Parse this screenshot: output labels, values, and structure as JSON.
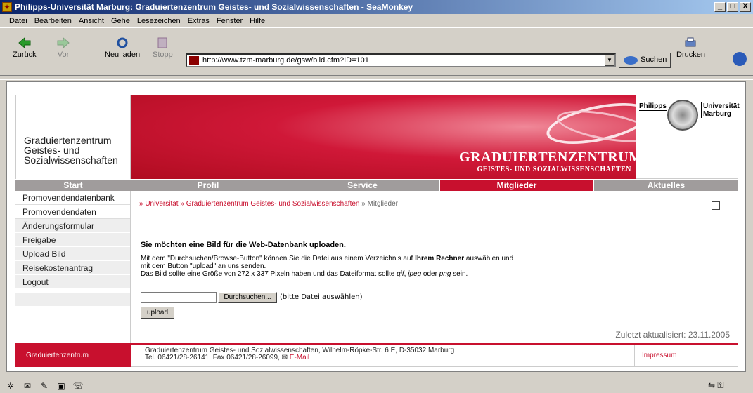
{
  "window": {
    "title": "Philipps-Universität Marburg: Graduiertenzentrum Geistes- und Sozialwissenschaften - SeaMonkey",
    "min": "_",
    "max": "□",
    "close": "X"
  },
  "menu": [
    "Datei",
    "Bearbeiten",
    "Ansicht",
    "Gehe",
    "Lesezeichen",
    "Extras",
    "Fenster",
    "Hilfe"
  ],
  "toolbar": {
    "back": "Zurück",
    "forward": "Vor",
    "reload": "Neu laden",
    "stop": "Stopp",
    "url": "http://www.tzm-marburg.de/gsw/bild.cfm?ID=101",
    "search": "Suchen",
    "print": "Drucken"
  },
  "header": {
    "left_title_line1": "Graduiertenzentrum",
    "left_title_line2": "Geistes- und",
    "left_title_line3": "Sozialwissenschaften",
    "banner_title": "GRADUIERTENZENTRUM",
    "banner_subtitle": "GEISTES- UND SOZIALWISSENSCHAFTEN",
    "uni_left": "Philipps",
    "uni_right_line1": "Universität",
    "uni_right_line2": "Marburg"
  },
  "nav": [
    "Start",
    "Profil",
    "Service",
    "Mitglieder",
    "Aktuelles"
  ],
  "sidebar": [
    "Promovendendatenbank",
    "Promovendendaten",
    "Änderungsformular",
    "Freigabe",
    "Upload Bild",
    "Reisekostenantrag",
    "Logout"
  ],
  "breadcrumb": {
    "part1": "» Universität",
    "part2": "» Graduiertenzentrum Geistes- und Sozialwissenschaften",
    "part3": "» Mitglieder"
  },
  "main": {
    "heading": "Sie möchten eine Bild für die Web-Datenbank uploaden.",
    "p1a": "Mit dem \"Durchsuchen/Browse-Button\" können Sie die Datei aus einem Verzeichnis auf ",
    "p1b": "Ihrem Rechner",
    "p1c": " auswählen und",
    "p2": "mit dem Button \"upload\" an uns senden.",
    "p3a": "Das Bild sollte eine Größe von 272 x 337 Pixeln haben und das Dateiformat sollte ",
    "p3b": "gif",
    "p3c": ", ",
    "p3d": "jpeg",
    "p3e": " oder ",
    "p3f": "png",
    "p3g": " sein.",
    "browse": "Durchsuchen...",
    "hint": "(bitte Datei auswählen)",
    "upload": "upload",
    "updated": "Zuletzt aktualisiert: 23.11.2005"
  },
  "footer": {
    "left": "Graduiertenzentrum",
    "line1": "Graduiertenzentrum Geistes- und Sozialwissenschaften, Wilhelm-Röpke-Str. 6 E, D-35032 Marburg",
    "line2": "Tel. 06421/28-26141, Fax 06421/28-26099,",
    "email": "E-Mail",
    "impressum": "Impressum"
  }
}
